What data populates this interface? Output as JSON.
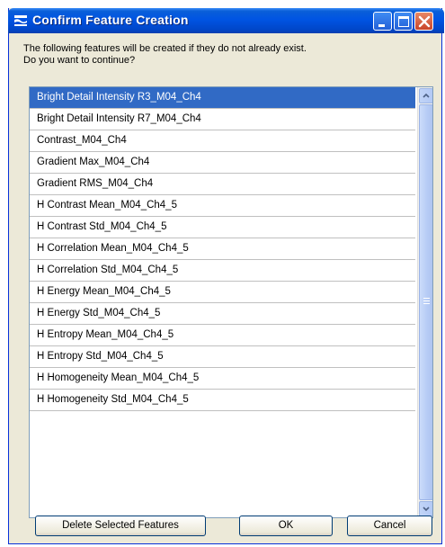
{
  "window": {
    "title": "Confirm Feature Creation"
  },
  "message": {
    "line1": "The following features will be created if they do not already exist.",
    "line2": "Do you want to continue?"
  },
  "features": [
    "Bright Detail Intensity R3_M04_Ch4",
    "Bright Detail Intensity R7_M04_Ch4",
    "Contrast_M04_Ch4",
    "Gradient Max_M04_Ch4",
    "Gradient RMS_M04_Ch4",
    "H Contrast Mean_M04_Ch4_5",
    "H Contrast Std_M04_Ch4_5",
    "H Correlation Mean_M04_Ch4_5",
    "H Correlation Std_M04_Ch4_5",
    "H Energy Mean_M04_Ch4_5",
    "H Energy Std_M04_Ch4_5",
    "H Entropy Mean_M04_Ch4_5",
    "H Entropy Std_M04_Ch4_5",
    "H Homogeneity Mean_M04_Ch4_5",
    "H Homogeneity Std_M04_Ch4_5"
  ],
  "selected_feature": "Bright Detail Intensity R3_M04_Ch4",
  "buttons": {
    "delete_label": "Delete Selected Features",
    "ok_label": "OK",
    "cancel_label": "Cancel"
  },
  "icons": {
    "app": "app-icon",
    "minimize": "minimize-icon",
    "maximize": "maximize-icon",
    "close": "close-icon",
    "scroll_up": "scroll-up-arrow-icon",
    "scroll_down": "scroll-down-arrow-icon"
  },
  "colors": {
    "titlebar": "#0054e3",
    "selection": "#316ac5",
    "dialog_bg": "#ece9d8"
  }
}
